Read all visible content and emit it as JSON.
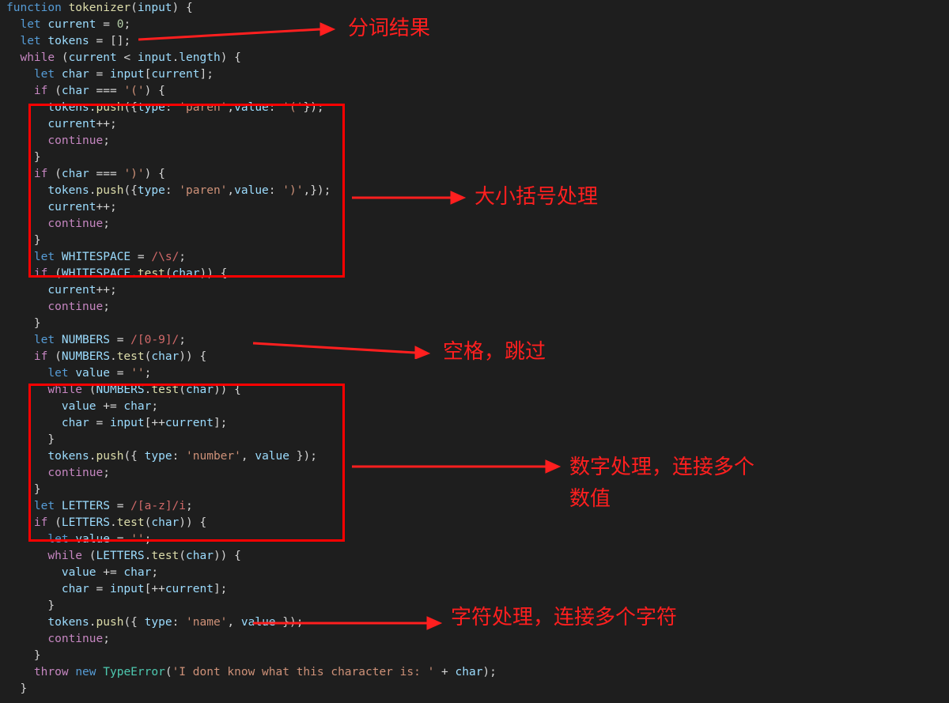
{
  "code": {
    "l1": "function tokenizer(input) {",
    "l2": "  let current = 0;",
    "l3": "  let tokens = [];",
    "l4": "  while (current < input.length) {",
    "l5": "    let char = input[current];",
    "l6": "    if (char === '(') {",
    "l7": "      tokens.push({type: 'paren',value: '('});",
    "l8": "      current++;",
    "l9": "      continue;",
    "l10": "    }",
    "l11": "    if (char === ')') {",
    "l12": "      tokens.push({type: 'paren',value: ')',});",
    "l13": "      current++;",
    "l14": "      continue;",
    "l15": "    }",
    "l16": "    let WHITESPACE = /\\s/;",
    "l17": "    if (WHITESPACE.test(char)) {",
    "l18": "      current++;",
    "l19": "      continue;",
    "l20": "    }",
    "l21": "    let NUMBERS = /[0-9]/;",
    "l22": "    if (NUMBERS.test(char)) {",
    "l23": "      let value = '';",
    "l24": "      while (NUMBERS.test(char)) {",
    "l25": "        value += char;",
    "l26": "        char = input[++current];",
    "l27": "      }",
    "l28": "      tokens.push({ type: 'number', value });",
    "l29": "      continue;",
    "l30": "    }",
    "l31": "    let LETTERS = /[a-z]/i;",
    "l32": "    if (LETTERS.test(char)) {",
    "l33": "      let value = '';",
    "l34": "      while (LETTERS.test(char)) {",
    "l35": "        value += char;",
    "l36": "        char = input[++current];",
    "l37": "      }",
    "l38": "      tokens.push({ type: 'name', value });",
    "l39": "      continue;",
    "l40": "    }",
    "l41": "    throw new TypeError('I dont know what this character is: ' + char);",
    "l42": "  }"
  },
  "annotations": {
    "tokens": "分词结果",
    "paren": "大小括号处理",
    "space": "空格，跳过",
    "number": "数字处理，连接多个\n数值",
    "letters": "字符处理，连接多个字符"
  }
}
